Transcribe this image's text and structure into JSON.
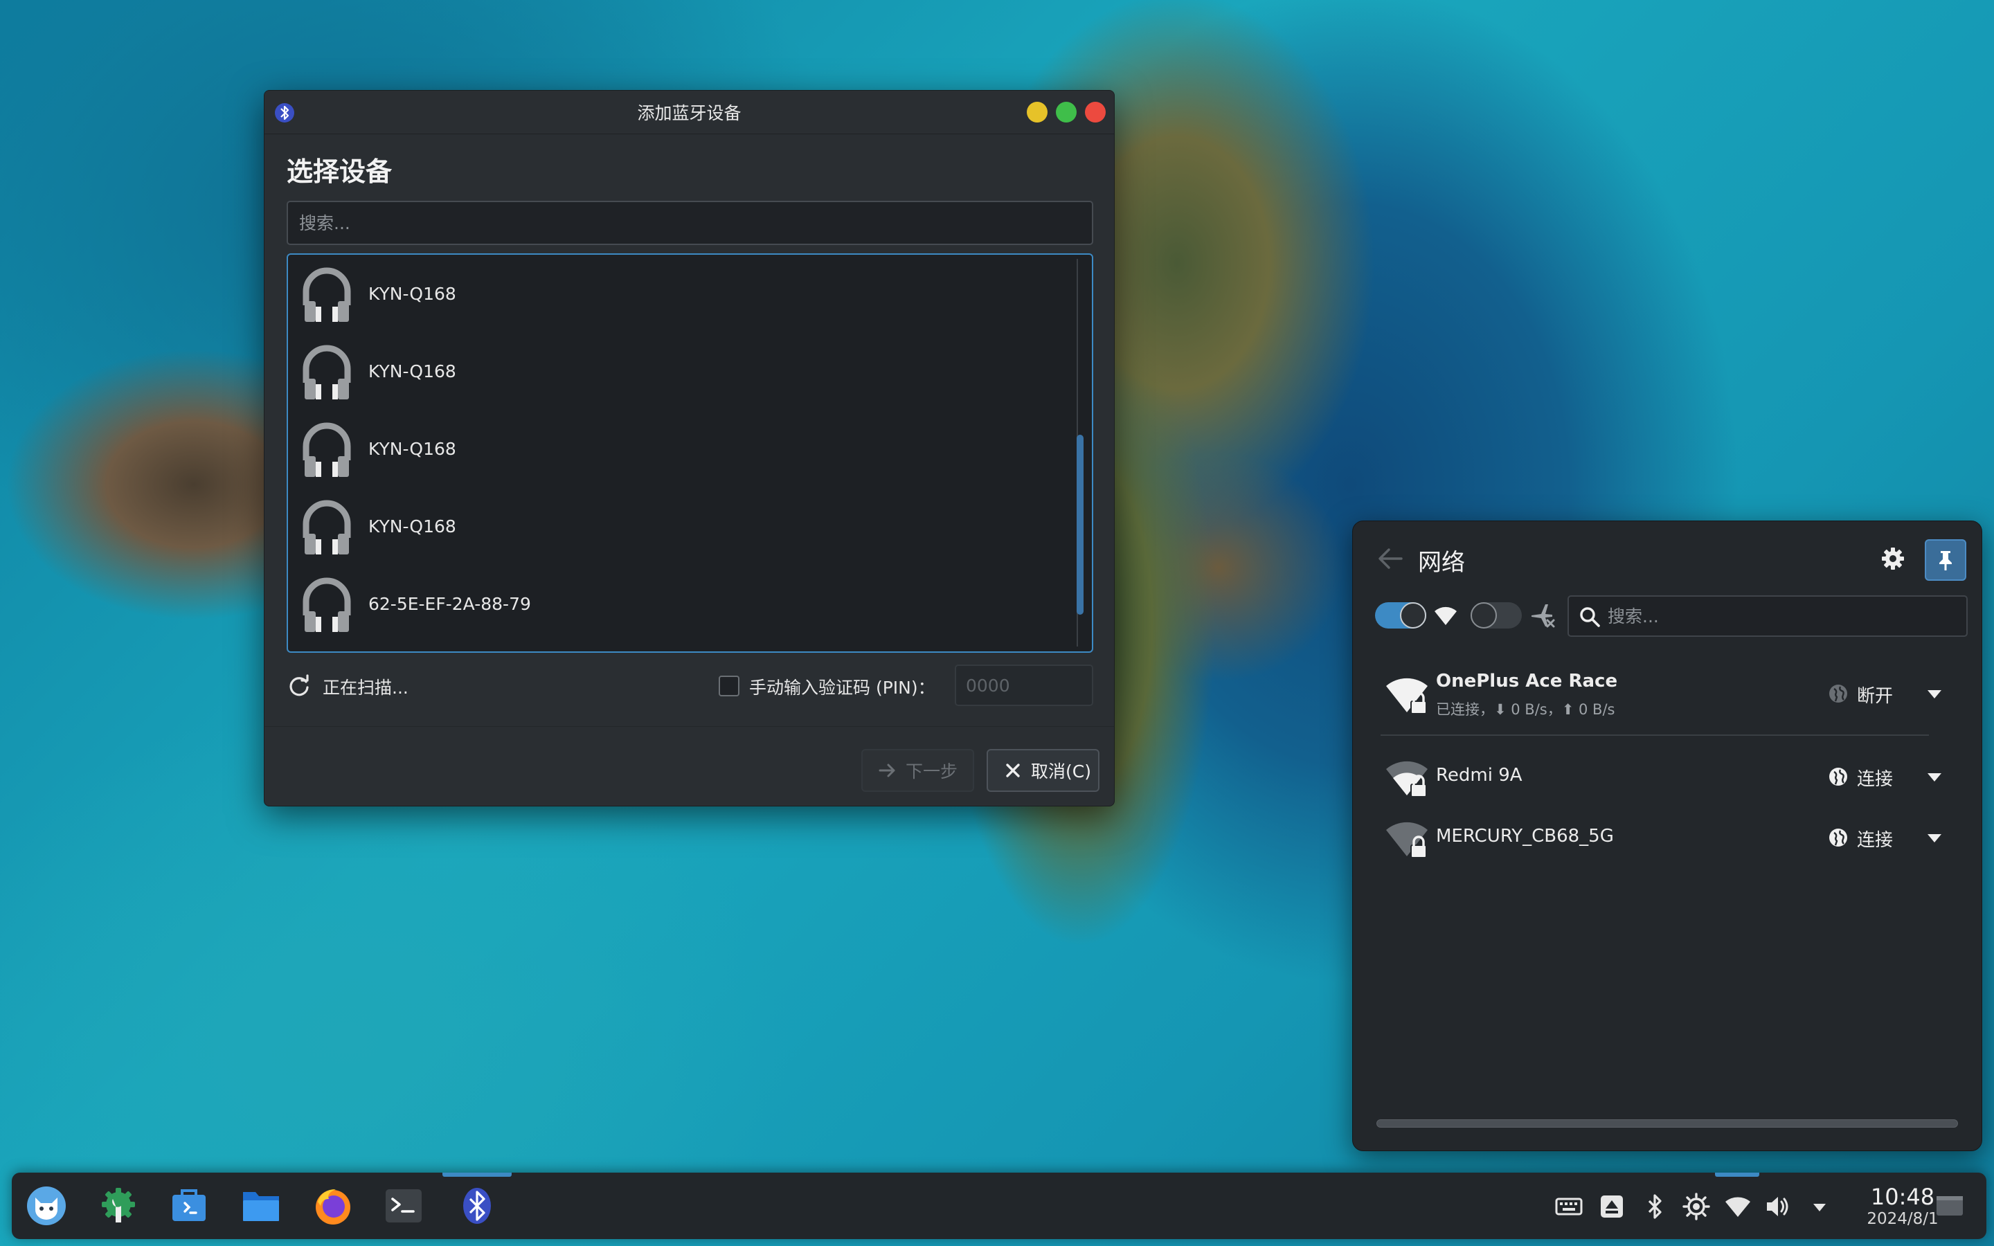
{
  "bluetooth_dialog": {
    "title": "添加蓝牙设备",
    "heading": "选择设备",
    "search_placeholder": "搜索...",
    "devices": [
      {
        "name": "KYN-Q168",
        "icon": "headphones-icon"
      },
      {
        "name": "KYN-Q168",
        "icon": "headphones-icon"
      },
      {
        "name": "KYN-Q168",
        "icon": "headphones-icon"
      },
      {
        "name": "KYN-Q168",
        "icon": "headphones-icon"
      },
      {
        "name": "62-5E-EF-2A-88-79",
        "icon": "headphones-icon"
      }
    ],
    "scanning_label": "正在扫描...",
    "pin_checkbox_label": "手动输入验证码 (PIN)：",
    "pin_placeholder": "0000",
    "next_button": "下一步",
    "cancel_button": "取消(C)"
  },
  "network_panel": {
    "title": "网络",
    "search_placeholder": "搜索...",
    "networks": [
      {
        "name": "OnePlus Ace Race",
        "status": "已连接，⬇ 0 B/s，⬆ 0 B/s",
        "action": "断开",
        "connected": true
      },
      {
        "name": "Redmi 9A",
        "status": "",
        "action": "连接",
        "connected": false
      },
      {
        "name": "MERCURY_CB68_5G",
        "status": "",
        "action": "连接",
        "connected": false
      }
    ]
  },
  "taskbar": {
    "apps": [
      "launcher-icon",
      "settings-app-icon",
      "store-icon",
      "file-manager-icon",
      "firefox-icon",
      "terminal-icon",
      "bluetooth-app-icon"
    ],
    "time": "10:48",
    "date": "2024/8/1"
  },
  "colors": {
    "accent": "#3d8ac4",
    "window_bg": "#2a2e32",
    "panel_bg": "#23272b",
    "close": "#ec4a3f",
    "maximize": "#3fbe4a",
    "minimize": "#e6c229"
  }
}
